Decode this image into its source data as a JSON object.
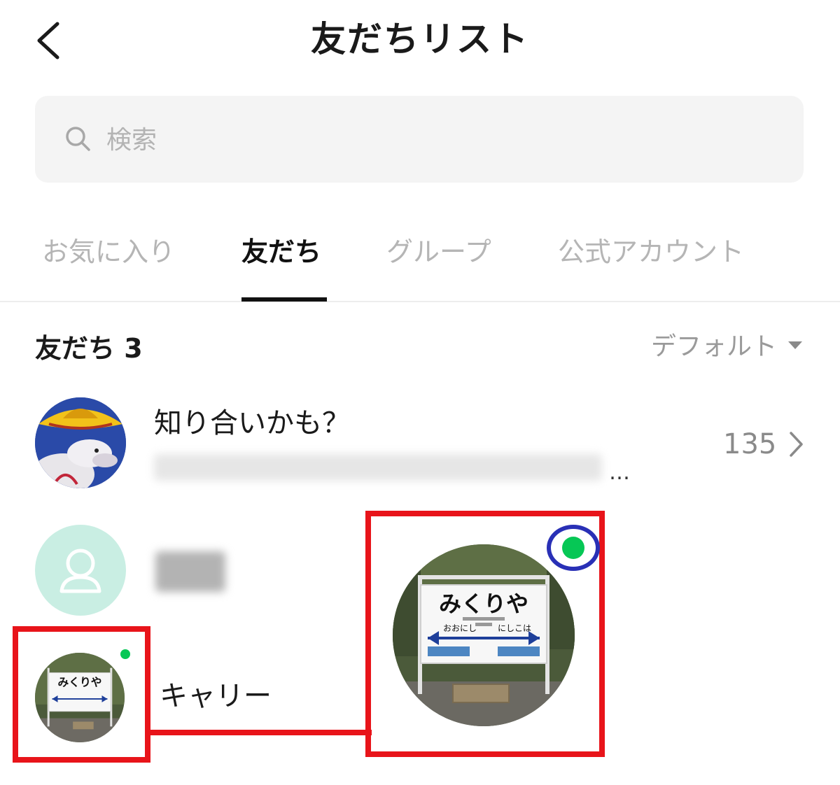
{
  "header": {
    "title": "友だちリスト",
    "back_icon": "chevron-left-icon"
  },
  "search": {
    "placeholder": "検索",
    "icon": "search-icon"
  },
  "tabs": [
    {
      "label": "お気に入り",
      "active": false
    },
    {
      "label": "友だち",
      "active": true
    },
    {
      "label": "グループ",
      "active": false
    },
    {
      "label": "公式アカウント",
      "active": false
    }
  ],
  "section": {
    "label": "友だち 3",
    "sort": "デフォルト"
  },
  "suggestion": {
    "title": "知り合いかも？",
    "ellipsis": "…",
    "count": "135"
  },
  "friends": [
    {
      "name": "",
      "avatar": "default-person-icon"
    },
    {
      "name": "キャリー",
      "avatar": "station-sign-photo",
      "online": true
    }
  ],
  "station_sign": {
    "name": "みくりや",
    "left": "おおにし",
    "right": "にしこは"
  },
  "colors": {
    "highlight_red": "#e8141a",
    "highlight_blue": "#2930b6",
    "online_green": "#06c755",
    "default_avatar_bg": "#c9eee3"
  }
}
